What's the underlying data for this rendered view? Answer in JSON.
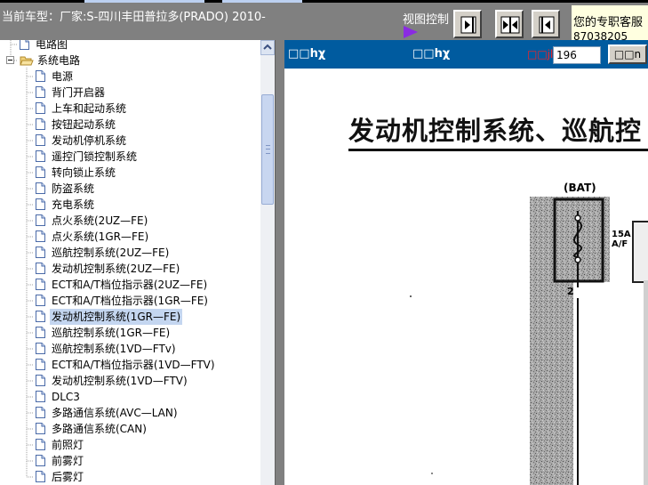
{
  "header": {
    "current_model": "当前车型：厂家:S-四川丰田普拉多(PRADO) 2010-",
    "view_control_label": "视图控制",
    "hotline_label": "您的专职客服",
    "hotline_number": "87038205"
  },
  "view_buttons": [
    {
      "icon": "arrow-right-bar-icon"
    },
    {
      "icon": "arrows-split-icon"
    },
    {
      "icon": "arrow-left-bar-icon"
    }
  ],
  "tree": {
    "items": [
      {
        "label": "电路图",
        "level": 1,
        "type": "doc"
      },
      {
        "label": "系统电路",
        "level": 1,
        "type": "folder",
        "expanded": true
      },
      {
        "label": "电源",
        "level": 2,
        "type": "doc"
      },
      {
        "label": "背门开启器",
        "level": 2,
        "type": "doc"
      },
      {
        "label": "上车和起动系统",
        "level": 2,
        "type": "doc"
      },
      {
        "label": "按钮起动系统",
        "level": 2,
        "type": "doc"
      },
      {
        "label": "发动机停机系统",
        "level": 2,
        "type": "doc"
      },
      {
        "label": "遥控门锁控制系统",
        "level": 2,
        "type": "doc"
      },
      {
        "label": "转向锁止系统",
        "level": 2,
        "type": "doc"
      },
      {
        "label": "防盗系统",
        "level": 2,
        "type": "doc"
      },
      {
        "label": "充电系统",
        "level": 2,
        "type": "doc"
      },
      {
        "label": "点火系统(2UZ—FE)",
        "level": 2,
        "type": "doc"
      },
      {
        "label": "点火系统(1GR—FE)",
        "level": 2,
        "type": "doc"
      },
      {
        "label": "巡航控制系统(2UZ—FE)",
        "level": 2,
        "type": "doc"
      },
      {
        "label": "发动机控制系统(2UZ—FE)",
        "level": 2,
        "type": "doc"
      },
      {
        "label": "ECT和A/T档位指示器(2UZ—FE)",
        "level": 2,
        "type": "doc"
      },
      {
        "label": "ECT和A/T档位指示器(1GR—FE)",
        "level": 2,
        "type": "doc"
      },
      {
        "label": "发动机控制系统(1GR—FE)",
        "level": 2,
        "type": "doc",
        "selected": true
      },
      {
        "label": "巡航控制系统(1GR—FE)",
        "level": 2,
        "type": "doc"
      },
      {
        "label": "巡航控制系统(1VD—FTv)",
        "level": 2,
        "type": "doc"
      },
      {
        "label": "ECT和A/T档位指示器(1VD—FTV)",
        "level": 2,
        "type": "doc"
      },
      {
        "label": "发动机控制系统(1VD—FTV)",
        "level": 2,
        "type": "doc"
      },
      {
        "label": "DLC3",
        "level": 2,
        "type": "doc"
      },
      {
        "label": "多路通信系统(AVC—LAN)",
        "level": 2,
        "type": "doc"
      },
      {
        "label": "多路通信系统(CAN)",
        "level": 2,
        "type": "doc"
      },
      {
        "label": "前照灯",
        "level": 2,
        "type": "doc"
      },
      {
        "label": "前雾灯",
        "level": 2,
        "type": "doc"
      },
      {
        "label": "后雾灯",
        "level": 2,
        "type": "doc"
      }
    ]
  },
  "doc_toolbar": {
    "prev_label": "□□hχ",
    "next_label": "□□hχ",
    "page_label": "□□jl",
    "page_value": "196",
    "go_label": "□□n"
  },
  "document": {
    "title": "发动机控制系统、巡航控",
    "bat_label": "(BAT)",
    "fuse_rating": "15A",
    "fuse_name": "A/F",
    "pin_label": "2"
  },
  "colors": {
    "toolbar_blue": "#005b9f",
    "header_gray": "#808080",
    "selection": "#c4d6f0",
    "hotline_bg": "#ffffe0",
    "page_label_red": "#ff2020"
  }
}
